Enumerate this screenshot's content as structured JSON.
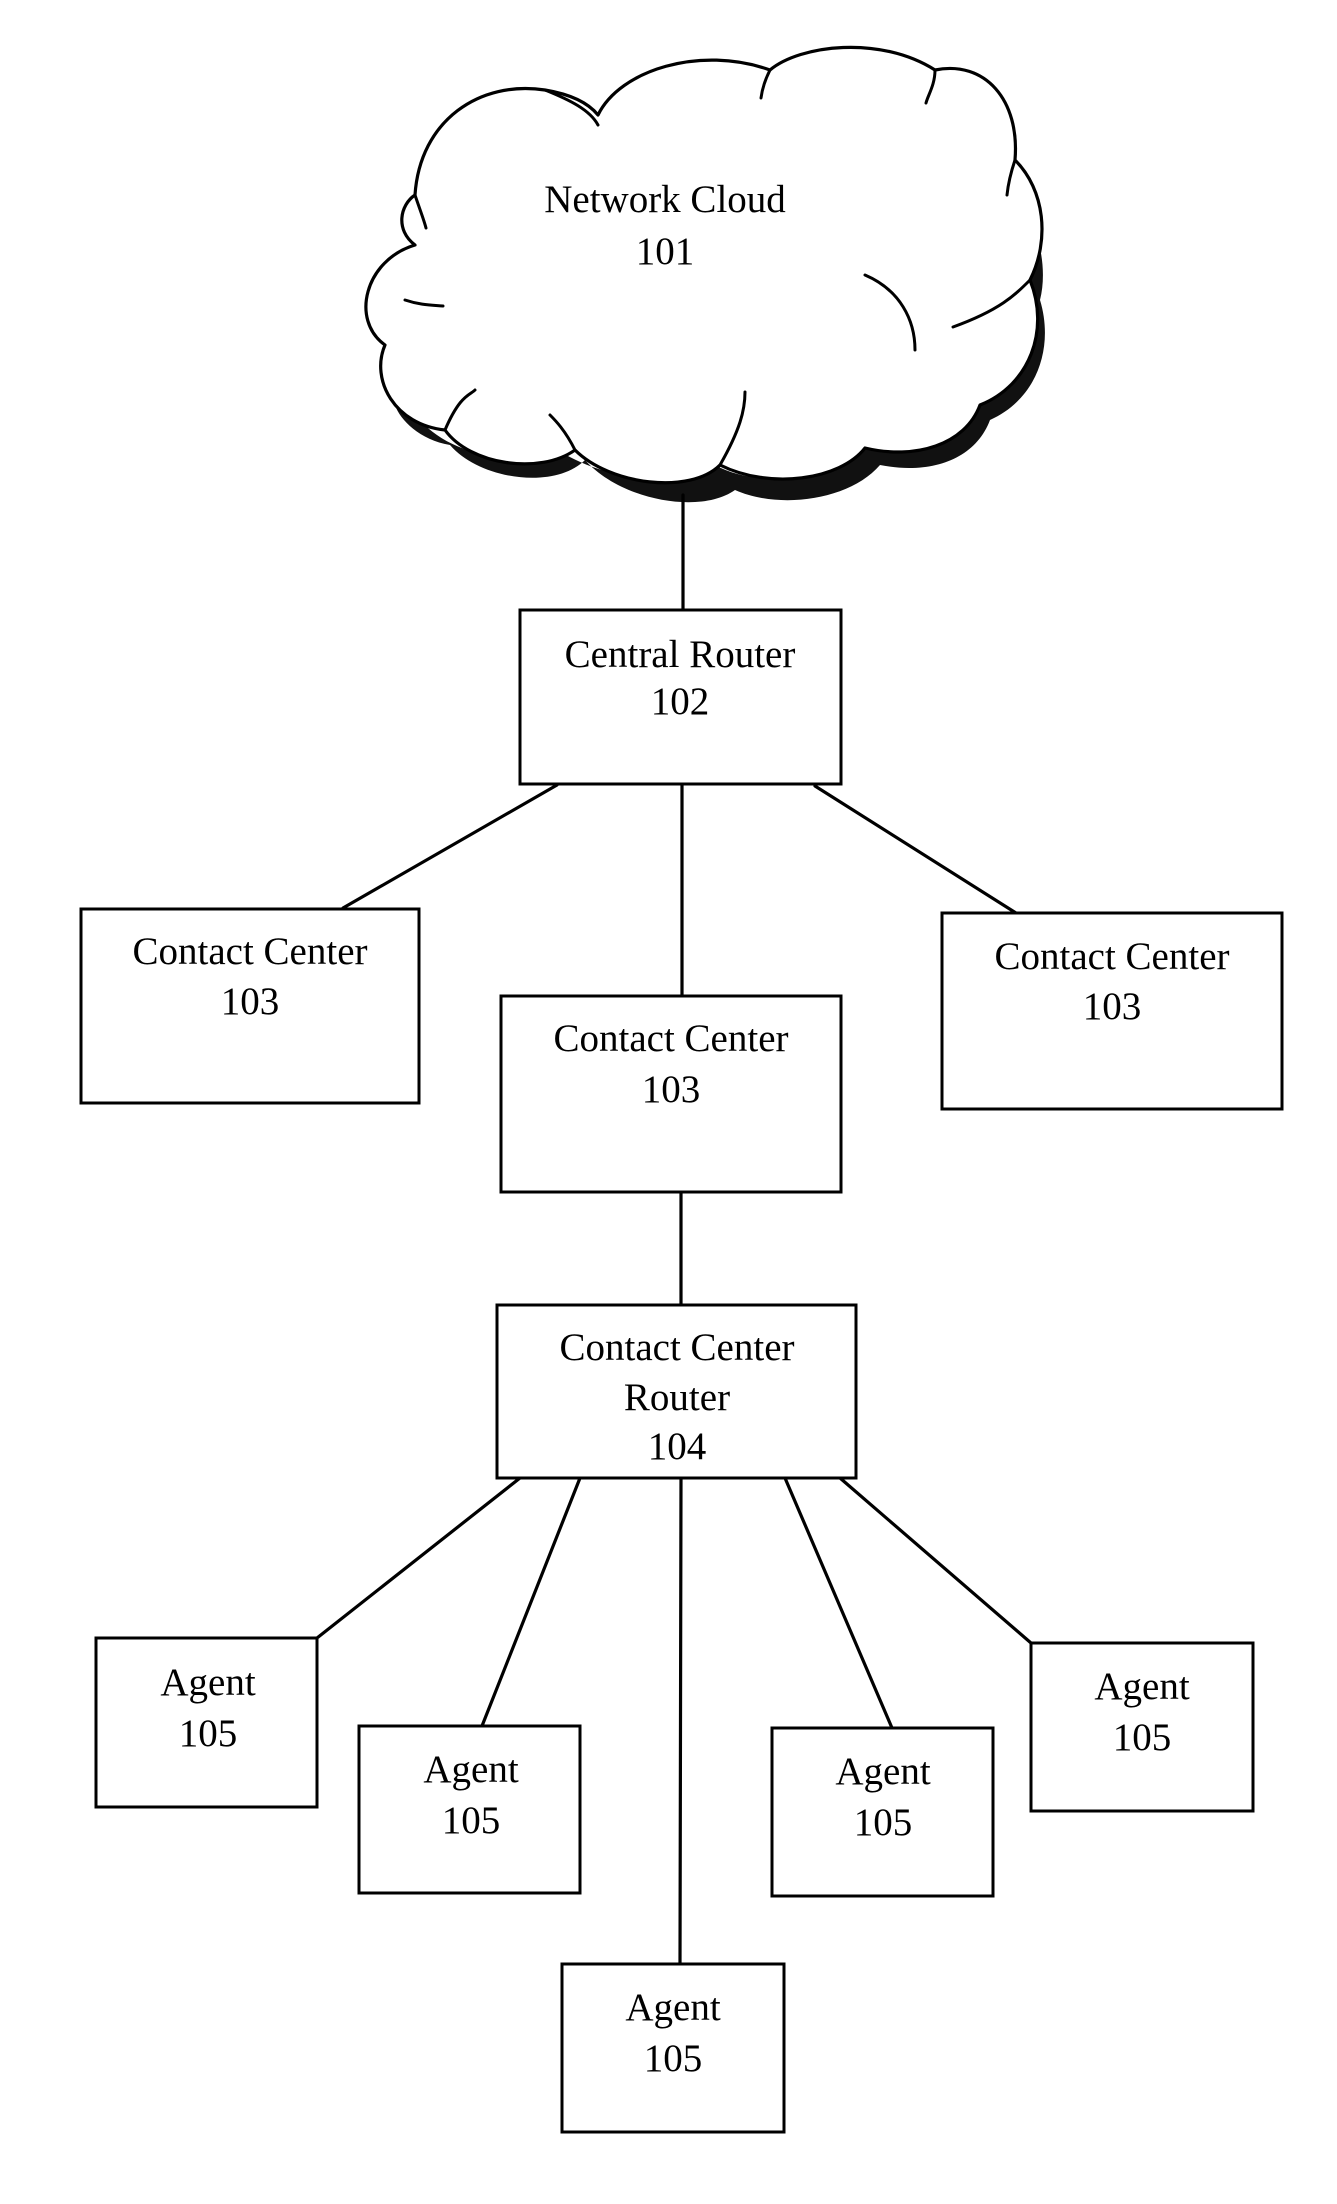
{
  "diagram": {
    "type": "network-topology",
    "nodes": {
      "network_cloud": {
        "id": "101",
        "label": "Network Cloud",
        "number": "101"
      },
      "central_router": {
        "id": "102",
        "label": "Central Router",
        "number": "102"
      },
      "contact_center_left": {
        "id": "103",
        "label": "Contact Center",
        "number": "103"
      },
      "contact_center_middle": {
        "id": "103",
        "label": "Contact Center",
        "number": "103"
      },
      "contact_center_right": {
        "id": "103",
        "label": "Contact Center",
        "number": "103"
      },
      "contact_center_router": {
        "id": "104",
        "label_line1": "Contact Center",
        "label_line2": "Router",
        "number": "104"
      },
      "agents": [
        {
          "label": "Agent",
          "number": "105"
        },
        {
          "label": "Agent",
          "number": "105"
        },
        {
          "label": "Agent",
          "number": "105"
        },
        {
          "label": "Agent",
          "number": "105"
        },
        {
          "label": "Agent",
          "number": "105"
        }
      ]
    },
    "edges": [
      {
        "from": "Network Cloud 101",
        "to": "Central Router 102"
      },
      {
        "from": "Central Router 102",
        "to": "Contact Center 103 (left)"
      },
      {
        "from": "Central Router 102",
        "to": "Contact Center 103 (middle)"
      },
      {
        "from": "Central Router 102",
        "to": "Contact Center 103 (right)"
      },
      {
        "from": "Contact Center 103 (middle)",
        "to": "Contact Center Router 104"
      },
      {
        "from": "Contact Center Router 104",
        "to": "Agent 105 (1)"
      },
      {
        "from": "Contact Center Router 104",
        "to": "Agent 105 (2)"
      },
      {
        "from": "Contact Center Router 104",
        "to": "Agent 105 (3)"
      },
      {
        "from": "Contact Center Router 104",
        "to": "Agent 105 (4)"
      },
      {
        "from": "Contact Center Router 104",
        "to": "Agent 105 (5)"
      }
    ]
  }
}
